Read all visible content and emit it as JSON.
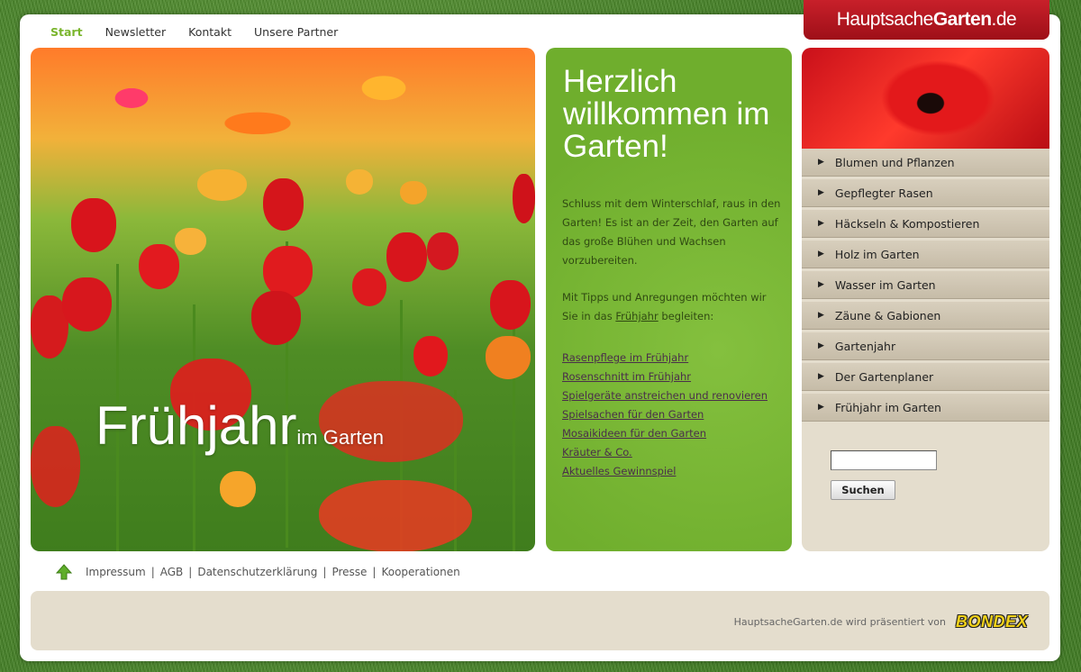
{
  "nav": {
    "items": [
      {
        "label": "Start",
        "active": true
      },
      {
        "label": "Newsletter",
        "active": false
      },
      {
        "label": "Kontakt",
        "active": false
      },
      {
        "label": "Unsere Partner",
        "active": false
      }
    ]
  },
  "logo": {
    "part1": "Hauptsache",
    "part2": "Garten",
    "part3": ".de"
  },
  "hero": {
    "title": "Frühjahr",
    "subtitle": "im Garten"
  },
  "welcome": {
    "heading": "Herzlich willkommen im Garten!",
    "paragraph1": "Schluss mit dem Winterschlaf, raus in den Garten! Es ist an der Zeit, den Garten auf das große Blühen und Wachsen vorzubereiten.",
    "paragraph2_before": "Mit Tipps und Anregungen möchten wir Sie in das ",
    "paragraph2_link": "Frühjahr",
    "paragraph2_after": " begleiten:",
    "links": [
      "Rasenpflege im Frühjahr",
      "Rosenschnitt im Frühjahr",
      "Spielgeräte anstreichen und renovieren",
      "Spielsachen für den Garten",
      "Mosaikideen für den Garten",
      "Kräuter & Co.",
      "Aktuelles Gewinnspiel"
    ]
  },
  "menu": {
    "items": [
      "Blumen und Pflanzen",
      "Gepflegter Rasen",
      "Häckseln & Kompostieren",
      "Holz im Garten",
      "Wasser im Garten",
      "Zäune & Gabionen",
      "Gartenjahr",
      "Der Gartenplaner",
      "Frühjahr im Garten"
    ]
  },
  "search": {
    "value": "",
    "button_label": "Suchen"
  },
  "footer": {
    "links": [
      "Impressum",
      "AGB",
      "Datenschutzerklärung",
      "Presse",
      "Kooperationen"
    ],
    "sponsor_text": "HauptsacheGarten.de wird präsentiert von",
    "sponsor_logo": "BONDEX"
  },
  "colors": {
    "accent_green": "#7ab52d",
    "brand_red": "#b5151f",
    "panel_beige": "#e4ddcd"
  }
}
